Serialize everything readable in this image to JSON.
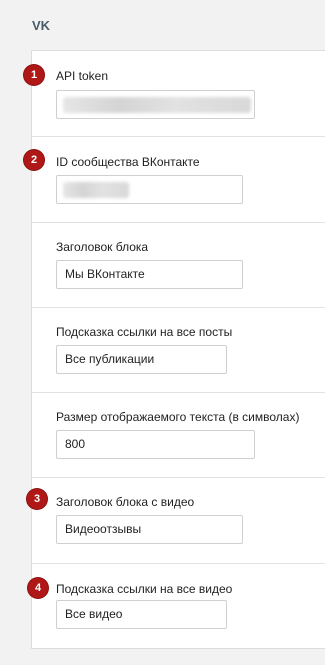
{
  "section": {
    "title": "VK"
  },
  "fields": [
    {
      "badge": "1",
      "label": "API token",
      "value": ""
    },
    {
      "badge": "2",
      "label": "ID сообщества ВКонтакте",
      "value": ""
    },
    {
      "label": "Заголовок блока",
      "value": "Мы ВКонтакте"
    },
    {
      "label": "Подсказка ссылки на все посты",
      "value": "Все публикации"
    },
    {
      "label": "Размер отображаемого текста (в символах)",
      "value": "800"
    },
    {
      "badge": "3",
      "label": "Заголовок блока с видео",
      "value": "Видеоотзывы"
    },
    {
      "badge": "4",
      "label": "Подсказка ссылки на все видео",
      "value": "Все видео"
    }
  ],
  "colors": {
    "badge": "#b01818",
    "title": "#4a5a6a",
    "border": "#dddddd"
  }
}
